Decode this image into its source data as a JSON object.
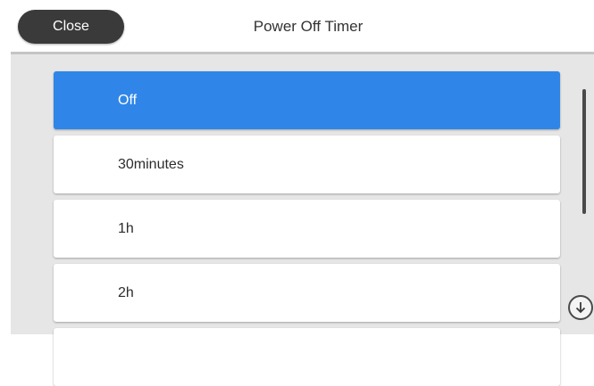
{
  "header": {
    "close_label": "Close",
    "title": "Power Off Timer"
  },
  "options": [
    {
      "label": "Off",
      "selected": true
    },
    {
      "label": "30minutes",
      "selected": false
    },
    {
      "label": "1h",
      "selected": false
    },
    {
      "label": "2h",
      "selected": false
    }
  ],
  "icons": {
    "scroll_down": "arrow-down-circle-icon"
  },
  "colors": {
    "selected": "#2f86e8",
    "close_button": "#3a3a3a",
    "panel_background": "#e6e6e6"
  }
}
